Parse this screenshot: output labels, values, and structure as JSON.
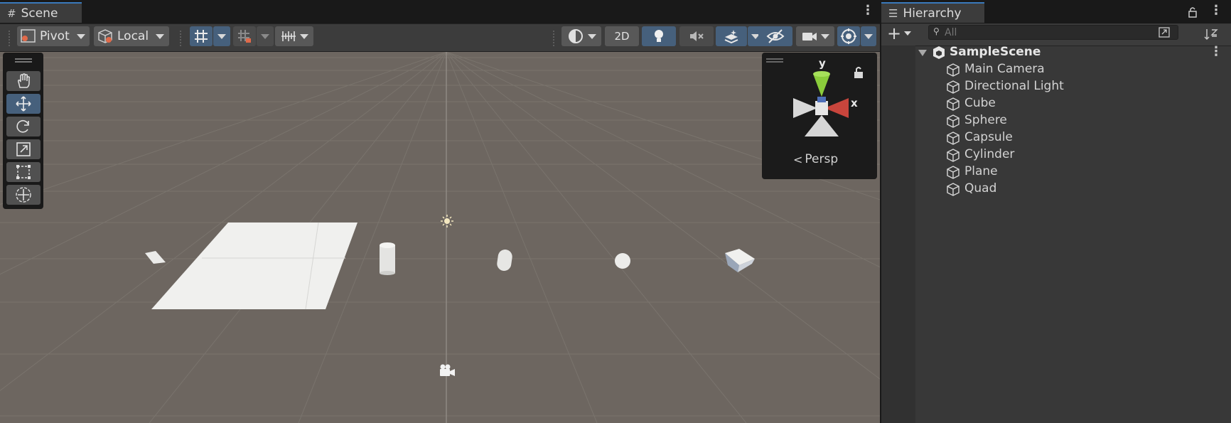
{
  "scene_tab": {
    "label": "Scene",
    "icon": "grid-icon"
  },
  "toolbar": {
    "pivot_label": "Pivot",
    "space_label": "Local",
    "mode_2d_label": "2D"
  },
  "tools": [
    "view-hand",
    "move",
    "rotate",
    "scale",
    "rect",
    "transform"
  ],
  "gizmo": {
    "y_label": "y",
    "x_label": "x",
    "projection_label": "Persp"
  },
  "hierarchy": {
    "tab_label": "Hierarchy",
    "search_placeholder": "All",
    "scene_name": "SampleScene",
    "objects": [
      {
        "label": "Main Camera"
      },
      {
        "label": "Directional Light"
      },
      {
        "label": "Cube"
      },
      {
        "label": "Sphere"
      },
      {
        "label": "Capsule"
      },
      {
        "label": "Cylinder"
      },
      {
        "label": "Plane"
      },
      {
        "label": "Quad"
      }
    ]
  },
  "colors": {
    "accent_blue": "#46607c",
    "tab_highlight": "#3a79bb",
    "viewport_bg": "#6d6660",
    "gizmo_x": "#c8453c",
    "gizmo_y": "#8acc3b"
  }
}
